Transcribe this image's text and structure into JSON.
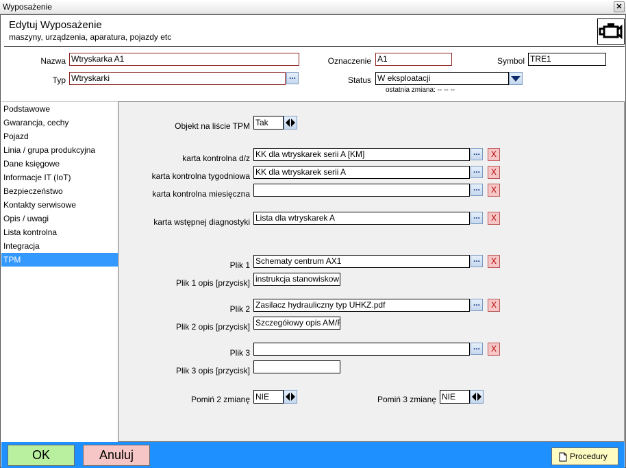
{
  "window": {
    "title": "Wyposażenie",
    "close_label": "✕"
  },
  "header": {
    "title": "Edytuj Wyposażenie",
    "subtitle": "maszyny, urządzenia, aparatura, pojazdy etc"
  },
  "form": {
    "nazwa_label": "Nazwa",
    "nazwa_value": "Wtryskarka A1",
    "typ_label": "Typ",
    "typ_value": "Wtryskarki",
    "oznaczenie_label": "Oznaczenie",
    "oznaczenie_value": "A1",
    "symbol_label": "Symbol",
    "symbol_value": "TRE1",
    "status_label": "Status",
    "status_value": "W eksploatacji",
    "last_change": "ostatnia zmiana: -- -- --"
  },
  "sidebar": {
    "items": [
      {
        "label": "Podstawowe"
      },
      {
        "label": "Gwarancja, cechy"
      },
      {
        "label": "Pojazd"
      },
      {
        "label": "Linia / grupa produkcyjna"
      },
      {
        "label": "Dane księgowe"
      },
      {
        "label": "Informacje IT (IoT)"
      },
      {
        "label": "Bezpieczeństwo"
      },
      {
        "label": "Kontakty serwisowe"
      },
      {
        "label": "Opis / uwagi"
      },
      {
        "label": "Lista kontrolna"
      },
      {
        "label": "Integracja"
      },
      {
        "label": "TPM"
      }
    ],
    "active_index": 11
  },
  "tpm": {
    "objekt_label": "Objekt na liście TPM",
    "objekt_value": "Tak",
    "kk_dz_label": "karta kontrolna d/z",
    "kk_dz_value": "KK dla wtryskarek serii A [KM]",
    "kk_tyg_label": "karta kontrolna tygodniowa",
    "kk_tyg_value": "KK dla wtryskarek serii A",
    "kk_mies_label": "karta kontrolna miesięczna",
    "kk_mies_value": "",
    "kwd_label": "karta wstępnej diagnostyki",
    "kwd_value": "Lista dla wtryskarek A",
    "plik1_label": "Plik 1",
    "plik1_value": "Schematy centrum AX1",
    "plik1_opis_label": "Plik 1 opis [przycisk]",
    "plik1_opis_value": "instrukcja stanowiskow",
    "plik2_label": "Plik 2",
    "plik2_value": "Zasilacz hydrauliczny typ UHKZ.pdf",
    "plik2_opis_label": "Plik 2 opis [przycisk]",
    "plik2_opis_value": "Szczegółowy opis AM/F",
    "plik3_label": "Plik 3",
    "plik3_value": "",
    "plik3_opis_label": "Plik 3 opis [przycisk]",
    "plik3_opis_value": "",
    "pomin2_label": "Pomiń 2 zmianę",
    "pomin2_value": "NIE",
    "pomin3_label": "Pomiń 3 zmianę",
    "pomin3_value": "NIE",
    "dots_label": "...",
    "x_label": "X"
  },
  "footer": {
    "ok_label": "OK",
    "cancel_label": "Anuluj",
    "procedury_label": "Procedury"
  },
  "colors": {
    "accent": "#1e90ff",
    "ok": "#b8f0a0",
    "cancel": "#f6c6c6",
    "procedury": "#fffcc2",
    "active_nav": "#3399ff"
  }
}
